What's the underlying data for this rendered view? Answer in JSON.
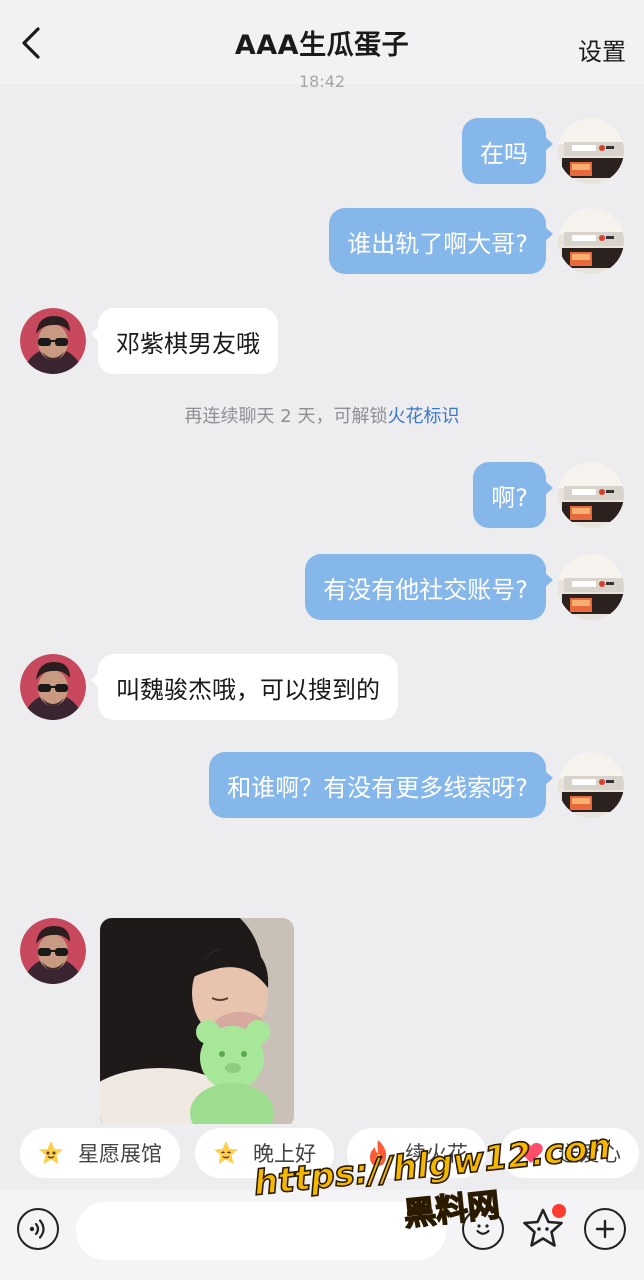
{
  "header": {
    "title": "AAA生瓜蛋子",
    "settings_label": "设置",
    "timestamp_peek": "18:42"
  },
  "messages": [
    {
      "side": "out",
      "text": "在吗"
    },
    {
      "side": "out",
      "text": "谁出轨了啊大哥?"
    },
    {
      "side": "in",
      "text": "邓紫棋男友哦"
    },
    {
      "side": "system",
      "text": "再连续聊天 2 天，可解锁",
      "highlight": "火花标识"
    },
    {
      "side": "out",
      "text": "啊?"
    },
    {
      "side": "out",
      "text": "有没有他社交账号?"
    },
    {
      "side": "in",
      "text": "叫魏骏杰哦，可以搜到的"
    },
    {
      "side": "out",
      "text": "和谁啊？有没有更多线索呀?"
    },
    {
      "side": "in",
      "type": "image",
      "icon": "photo-message"
    }
  ],
  "quick_replies": [
    {
      "label": "星愿展馆",
      "icon": "star-face-icon"
    },
    {
      "label": "晚上好",
      "icon": "star-face-icon"
    },
    {
      "label": "续火花",
      "icon": "flame-icon"
    },
    {
      "label": "送爱心",
      "icon": "heart-icon"
    }
  ],
  "input": {
    "placeholder": ""
  },
  "watermark": {
    "url_text": "https://hlgw12.com",
    "name_text": "黑料网"
  },
  "colors": {
    "outgoing_bubble": "#86b7ea",
    "incoming_bubble": "#ffffff",
    "background": "#ededf0",
    "highlight": "#3a78c9",
    "watermark_fill": "#f5b800"
  }
}
